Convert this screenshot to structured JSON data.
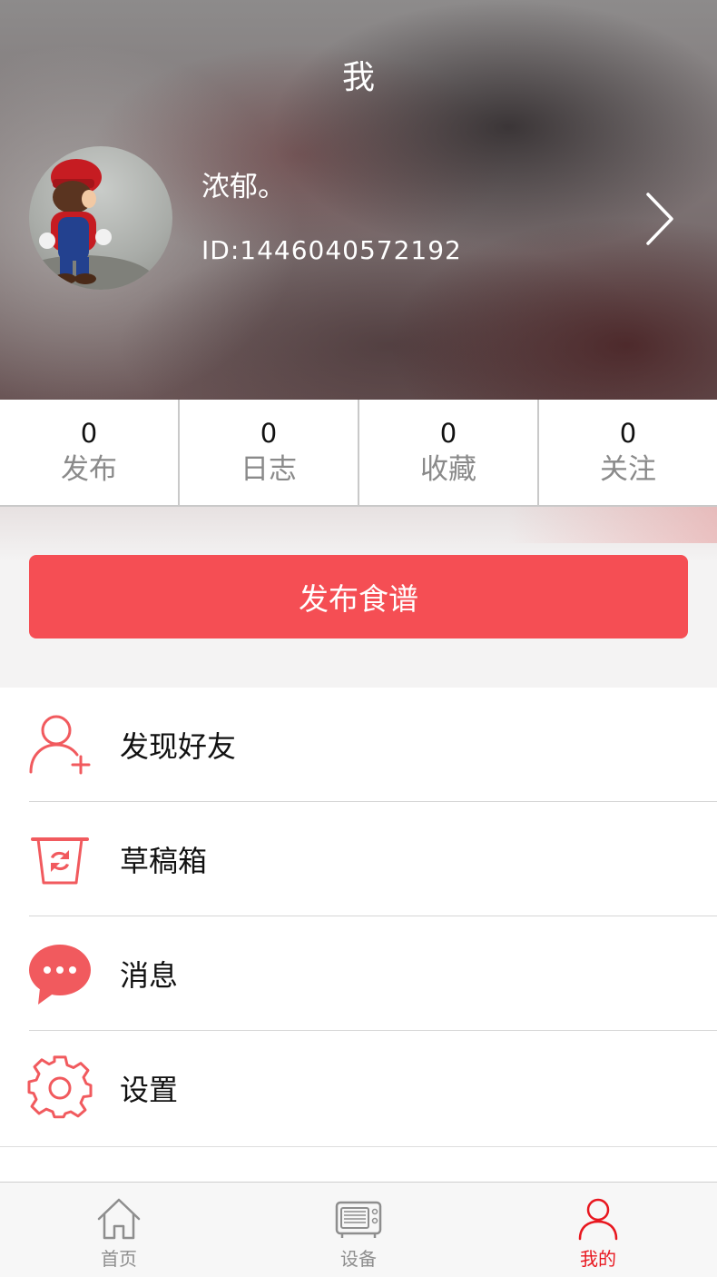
{
  "header": {
    "title": "我",
    "user_name": "浓郁。",
    "user_id": "ID:1446040572192"
  },
  "stats": [
    {
      "count": "0",
      "label": "发布"
    },
    {
      "count": "0",
      "label": "日志"
    },
    {
      "count": "0",
      "label": "收藏"
    },
    {
      "count": "0",
      "label": "关注"
    }
  ],
  "publish_button": "发布食谱",
  "menu": [
    {
      "label": "发现好友",
      "icon": "add-user-icon"
    },
    {
      "label": "草稿箱",
      "icon": "draft-box-icon"
    },
    {
      "label": "消息",
      "icon": "message-icon"
    },
    {
      "label": "设置",
      "icon": "gear-icon"
    }
  ],
  "tabbar": [
    {
      "label": "首页",
      "icon": "home-icon",
      "active": false
    },
    {
      "label": "设备",
      "icon": "oven-icon",
      "active": false
    },
    {
      "label": "我的",
      "icon": "person-icon",
      "active": true
    }
  ],
  "colors": {
    "accent": "#f54e54",
    "tab_active": "#e8171f",
    "tab_inactive": "#8e8e8e"
  }
}
